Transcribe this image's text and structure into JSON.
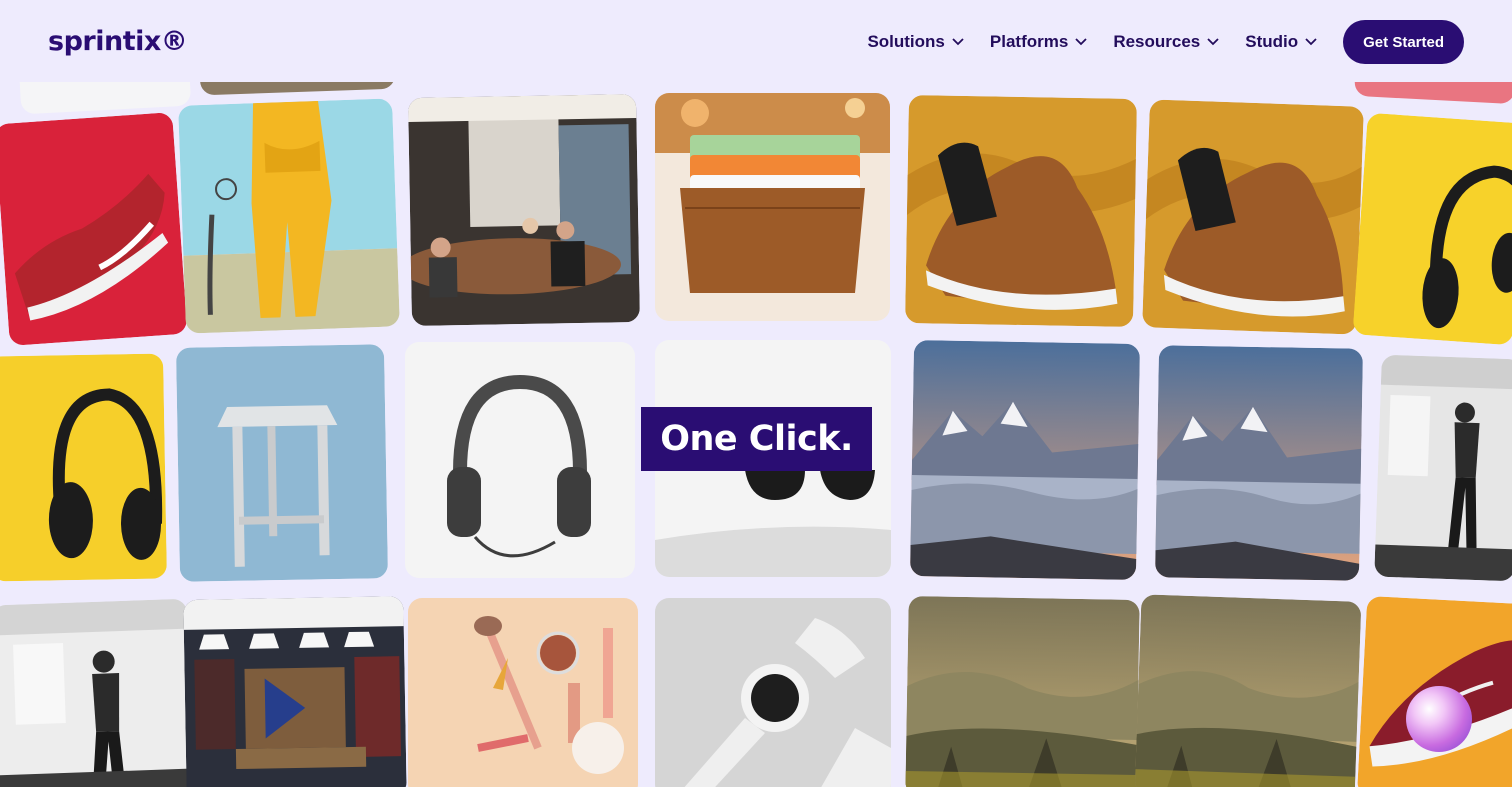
{
  "header": {
    "logo": "sprintix®",
    "nav": [
      {
        "label": "Solutions"
      },
      {
        "label": "Platforms"
      },
      {
        "label": "Resources"
      },
      {
        "label": "Studio"
      }
    ],
    "cta_label": "Get Started"
  },
  "hero": {
    "headline": "One Click."
  },
  "gallery": {
    "tiles": [
      {
        "subject": "red-sneaker"
      },
      {
        "subject": "yellow-tracksuit"
      },
      {
        "subject": "meeting-room"
      },
      {
        "subject": "leather-card-wallet"
      },
      {
        "subject": "brown-sneaker"
      },
      {
        "subject": "brown-sneaker"
      },
      {
        "subject": "headphones-yellow"
      },
      {
        "subject": "headphones-yellow"
      },
      {
        "subject": "stool-blue"
      },
      {
        "subject": "headphones-white"
      },
      {
        "subject": "sunglasses"
      },
      {
        "subject": "mountains-clouds"
      },
      {
        "subject": "mountains-clouds"
      },
      {
        "subject": "gym-woman"
      },
      {
        "subject": "gym-woman"
      },
      {
        "subject": "clothing-store"
      },
      {
        "subject": "makeup-brushes"
      },
      {
        "subject": "smartwatch"
      },
      {
        "subject": "mountain-valley"
      },
      {
        "subject": "mountain-valley"
      },
      {
        "subject": "maroon-sneaker"
      }
    ]
  },
  "colors": {
    "brand": "#2a0d73",
    "background": "#eeebfd"
  }
}
